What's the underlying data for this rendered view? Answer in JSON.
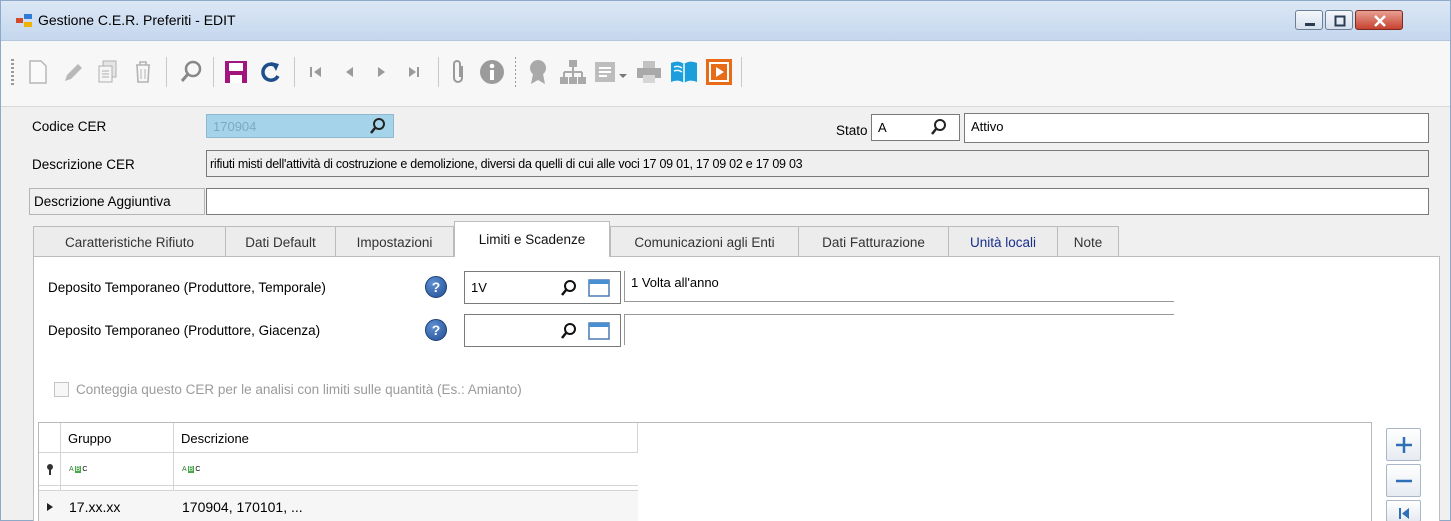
{
  "window": {
    "title": "Gestione C.E.R. Preferiti - EDIT"
  },
  "form": {
    "codice_cer_label": "Codice CER",
    "codice_cer_value": "170904",
    "stato_label": "Stato",
    "stato_code": "A",
    "stato_desc": "Attivo",
    "descrizione_cer_label": "Descrizione CER",
    "descrizione_cer_value": "rifiuti misti dell'attività di costruzione e demolizione, diversi da quelli di cui alle voci 17 09 01, 17 09 02 e 17 09 03",
    "descrizione_aggiuntiva_label": "Descrizione Aggiuntiva",
    "descrizione_aggiuntiva_value": ""
  },
  "tabs": [
    {
      "label": "Caratteristiche Rifiuto"
    },
    {
      "label": "Dati Default"
    },
    {
      "label": "Impostazioni"
    },
    {
      "label": "Limiti e Scadenze"
    },
    {
      "label": "Comunicazioni agli Enti"
    },
    {
      "label": "Dati Fatturazione"
    },
    {
      "label": "Unità locali"
    },
    {
      "label": "Note"
    }
  ],
  "active_tab": "Limiti e Scadenze",
  "limiti": {
    "dep_temporale_label": "Deposito Temporaneo (Produttore, Temporale)",
    "dep_temporale_code": "1V",
    "dep_temporale_desc": "1 Volta all'anno",
    "dep_giacenza_label": "Deposito Temporaneo (Produttore, Giacenza)",
    "dep_giacenza_code": "",
    "dep_giacenza_desc": "",
    "help_glyph": "?",
    "conteggia_label": "Conteggia questo CER per le analisi con limiti sulle quantità (Es.: Amianto)",
    "conteggia_checked": false
  },
  "grid": {
    "columns": [
      "Gruppo",
      "Descrizione"
    ],
    "filter_glyph": "ABC",
    "rows": [
      {
        "gruppo": "17.xx.xx",
        "descrizione": "170904, 170101, ..."
      }
    ]
  },
  "icons": {
    "toolbar": [
      "new-icon",
      "edit-icon",
      "copy-icon",
      "delete-icon",
      "search-icon",
      "save-icon",
      "undo-icon",
      "first-record-icon",
      "previous-record-icon",
      "next-record-icon",
      "last-record-icon",
      "attachment-icon",
      "info-icon",
      "certificate-icon",
      "hierarchy-icon",
      "export-dropdown-icon",
      "print-icon",
      "manual-icon",
      "video-icon"
    ]
  },
  "colors": {
    "codice_cer_bg": "#a5d3ea",
    "save_accent": "#a2157f",
    "help_blue": "#2f5fa8",
    "active_tab_text": "#111111",
    "blue_tab_text": "#1a2e8c"
  }
}
